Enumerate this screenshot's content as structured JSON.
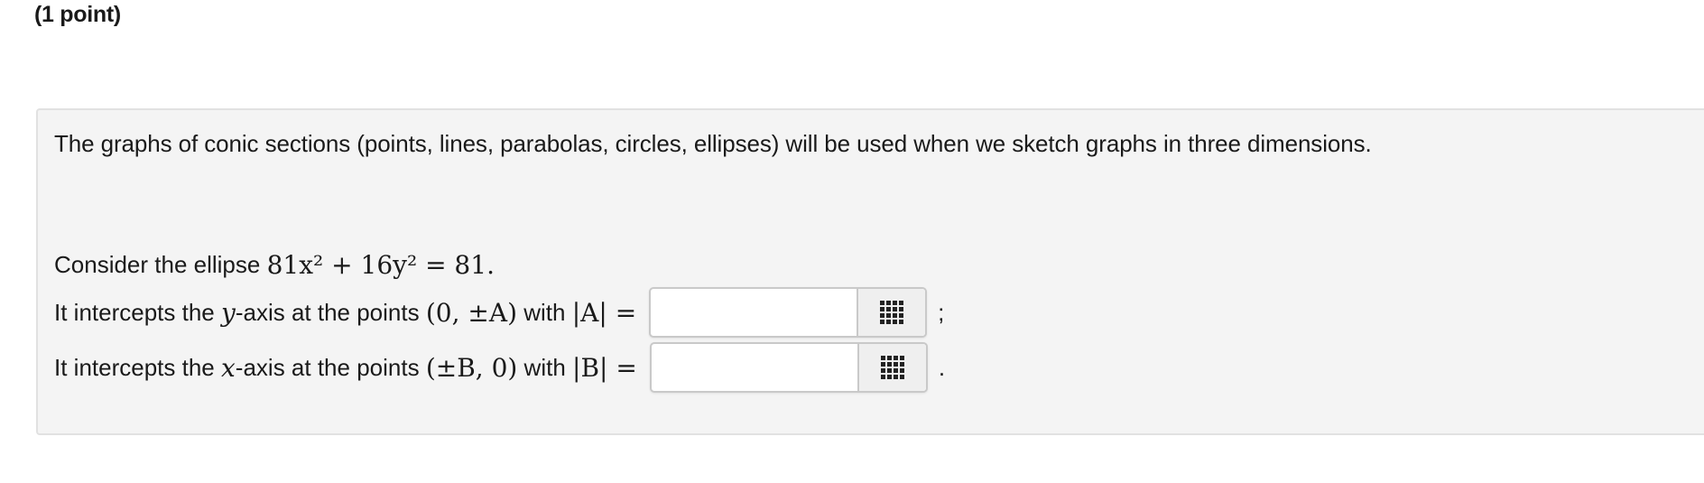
{
  "points_label": "(1 point)",
  "intro_text": "The graphs of conic sections (points, lines, parabolas, circles, ellipses) will be used when we sketch graphs in three dimensions.",
  "line1": {
    "prefix": "Consider the ellipse",
    "equation": "81x² + 16y² = 81."
  },
  "line2": {
    "prefix": "It intercepts the",
    "var": "y",
    "mid": "-axis at the points",
    "point": "(0, ±A)",
    "with": "with",
    "abs": "|A| =",
    "input_value": "",
    "suffix": ";"
  },
  "line3": {
    "prefix": "It intercepts the",
    "var": "x",
    "mid": "-axis at the points",
    "point": "(±B, 0)",
    "with": "with",
    "abs": "|B| =",
    "input_value": "",
    "suffix": "."
  },
  "icons": {
    "palette": "grid-icon"
  }
}
